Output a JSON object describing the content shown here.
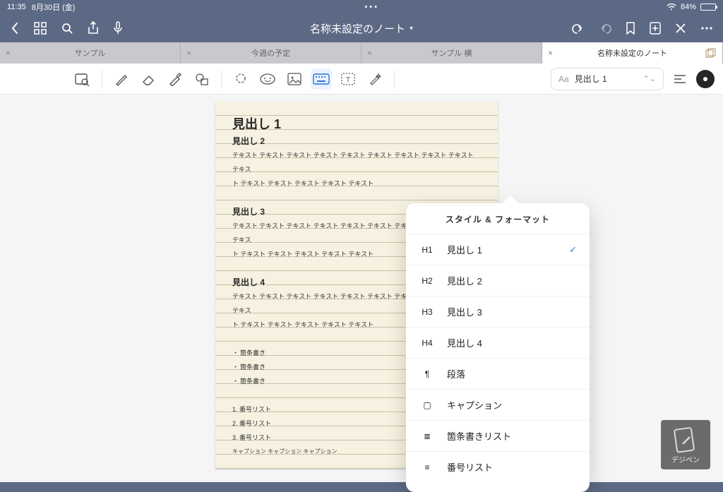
{
  "status": {
    "time": "11:35",
    "date": "8月30日 (金)",
    "battery_pct": "84%"
  },
  "header": {
    "title": "名称未設定のノート",
    "dropdown_glyph": "▾"
  },
  "tabs": [
    {
      "label": "サンプル"
    },
    {
      "label": "今週の予定"
    },
    {
      "label": "サンプル 横"
    },
    {
      "label": "名称未設定のノート",
      "active": true
    }
  ],
  "tools": {
    "zoom_label": "zoom",
    "style_label": "見出し 1",
    "aa_prefix": "Aa"
  },
  "doc": {
    "h1": "見出し 1",
    "h2a": "見出し 2",
    "body1a": "テキスト テキスト テキスト テキスト テキスト テキスト テキスト テキスト テキスト テキス",
    "body1b": "ト テキスト テキスト テキスト テキスト テキスト",
    "h2b": "見出し 3",
    "body2a": "テキスト テキスト テキスト テキスト テキスト テキスト テキスト テキスト テキスト テキス",
    "body2b": "ト テキスト テキスト テキスト テキスト テキスト",
    "h2c": "見出し 4",
    "body3a": "テキスト テキスト テキスト テキスト テキスト テキスト テキスト テキスト テキスト テキス",
    "body3b": "ト テキスト テキスト テキスト テキスト テキスト",
    "bul1": "箇条書き",
    "bul2": "箇条書き",
    "bul3": "箇条書き",
    "num1": "1. 番号リスト",
    "num2": "2. 番号リスト",
    "num3": "3. 番号リスト",
    "cap": "キャプション キャプション キャプション"
  },
  "popover": {
    "title": "スタイル & フォーマット",
    "items": [
      {
        "lead": "H1",
        "label": "見出し 1",
        "checked": true
      },
      {
        "lead": "H2",
        "label": "見出し 2"
      },
      {
        "lead": "H3",
        "label": "見出し 3"
      },
      {
        "lead": "H4",
        "label": "見出し 4"
      },
      {
        "lead": "¶",
        "label": "段落"
      },
      {
        "lead": "▢",
        "label": "キャプション"
      },
      {
        "lead": "≣",
        "label": "箇条書きリスト"
      },
      {
        "lead": "≡",
        "label": "番号リスト"
      }
    ]
  },
  "watermark": {
    "label": "デジペン"
  }
}
